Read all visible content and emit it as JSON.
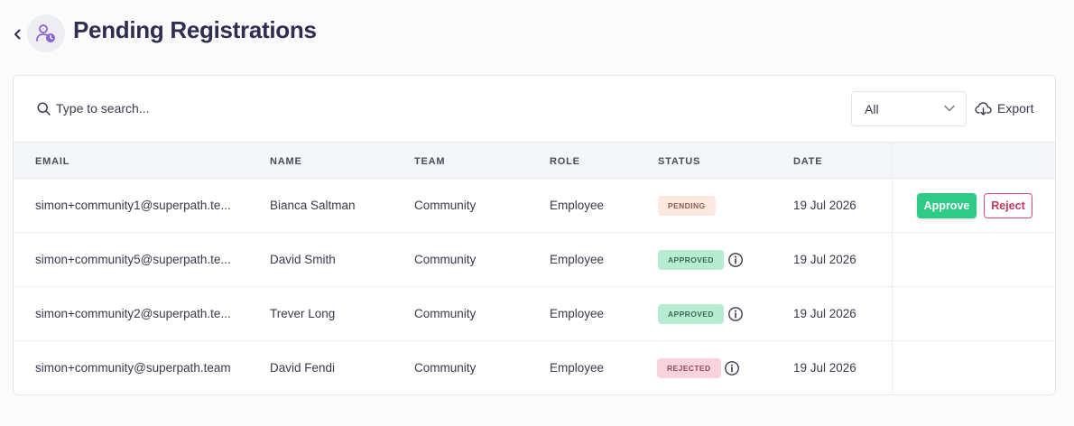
{
  "page": {
    "title": "Pending Registrations"
  },
  "toolbar": {
    "search_placeholder": "Type to search...",
    "filter_value": "All",
    "export_label": "Export"
  },
  "table": {
    "headers": {
      "email": "EMAIL",
      "name": "NAME",
      "team": "TEAM",
      "role": "ROLE",
      "status": "STATUS",
      "date": "DATE"
    },
    "rows": [
      {
        "email": "simon+community1@superpath.te...",
        "name": "Bianca Saltman",
        "team": "Community",
        "role": "Employee",
        "status": "PENDING",
        "date": "19 Jul 2026",
        "approve_label": "Approve",
        "reject_label": "Reject"
      },
      {
        "email": "simon+community5@superpath.te...",
        "name": "David Smith",
        "team": "Community",
        "role": "Employee",
        "status": "APPROVED",
        "date": "19 Jul 2026"
      },
      {
        "email": "simon+community2@superpath.te...",
        "name": "Trever Long",
        "team": "Community",
        "role": "Employee",
        "status": "APPROVED",
        "date": "19 Jul 2026"
      },
      {
        "email": "simon+community@superpath.team",
        "name": "David Fendi",
        "team": "Community",
        "role": "Employee",
        "status": "REJECTED",
        "date": "19 Jul 2026"
      }
    ]
  },
  "colors": {
    "title": "#2f2d52",
    "approve": "#2fca86",
    "reject": "#c3395c",
    "avatar_icon": "#8a63d2"
  }
}
